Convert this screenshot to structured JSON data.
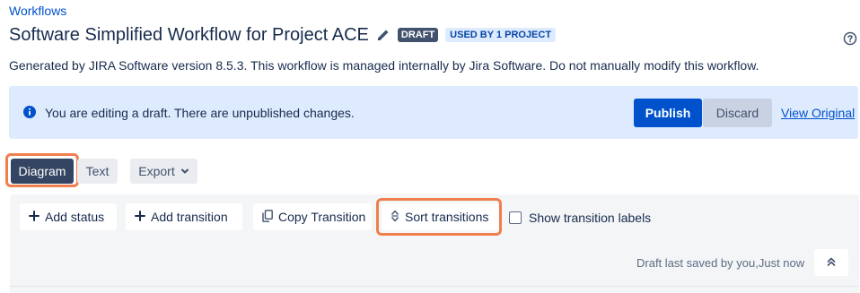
{
  "breadcrumb": "Workflows",
  "header": {
    "title": "Software Simplified Workflow for Project ACE",
    "draft_lozenge": "DRAFT",
    "used_lozenge": "USED BY 1 PROJECT"
  },
  "description": "Generated by JIRA Software version 8.5.3. This workflow is managed internally by Jira Software. Do not manually modify this workflow.",
  "banner": {
    "message": "You are editing a draft. There are unpublished changes.",
    "publish_label": "Publish",
    "discard_label": "Discard",
    "view_original_label": "View Original"
  },
  "view_tabs": {
    "diagram_label": "Diagram",
    "text_label": "Text",
    "export_label": "Export"
  },
  "toolbar": {
    "add_status_label": "Add status",
    "add_transition_label": "Add transition",
    "copy_transition_label": "Copy Transition",
    "sort_transitions_label": "Sort transitions",
    "show_labels_label": "Show transition labels",
    "saved_status": "Draft last saved by you,Just now"
  },
  "colors": {
    "primary": "#0052cc",
    "banner_bg": "#deebff",
    "highlight": "#f07f4e",
    "diagram_active": "#344563"
  },
  "icons": [
    "edit-icon",
    "help-icon",
    "info-icon",
    "chevron-down-icon",
    "plus-icon",
    "copy-icon",
    "sort-icon",
    "collapse-up-icon"
  ]
}
